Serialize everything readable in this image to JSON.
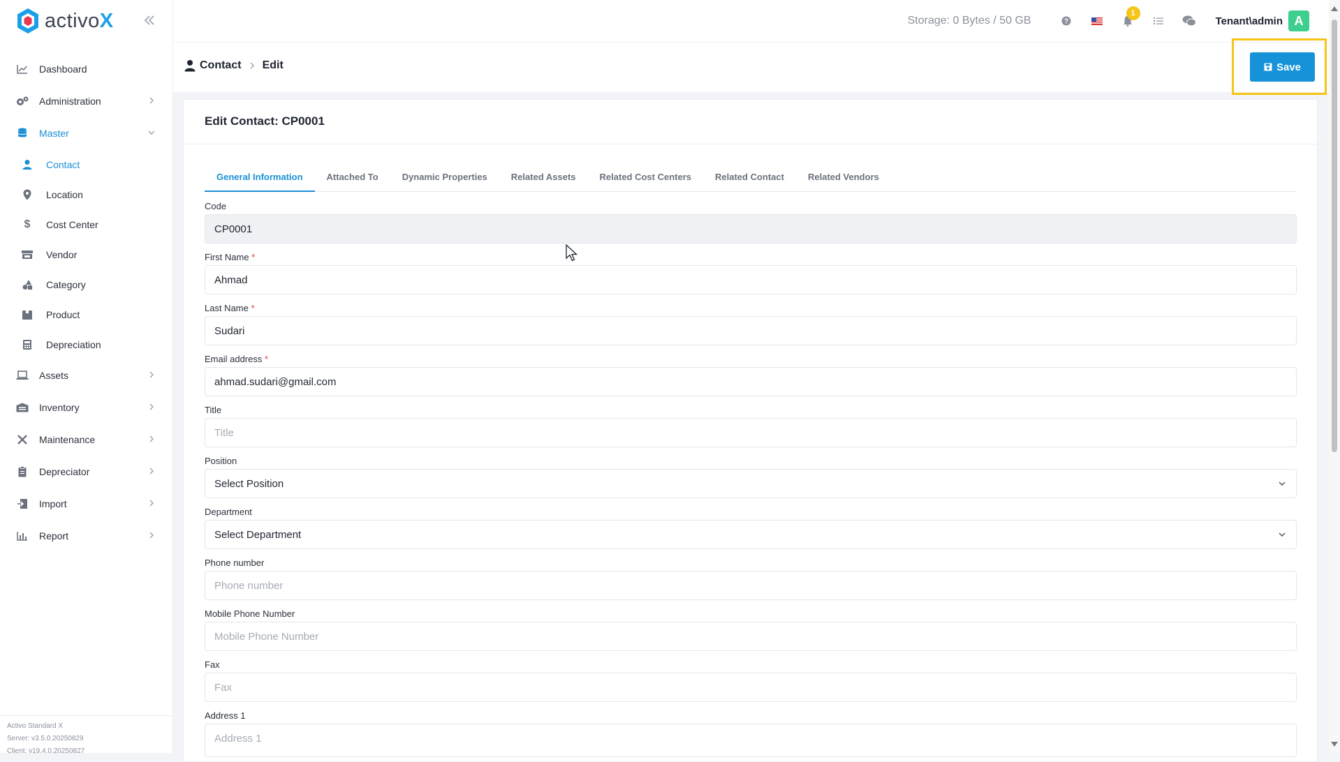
{
  "brand": {
    "name": "activo",
    "x": "X"
  },
  "sidebar": {
    "items": [
      {
        "label": "Dashboard",
        "icon": "chart-line-icon"
      },
      {
        "label": "Administration",
        "icon": "gears-icon"
      },
      {
        "label": "Master",
        "icon": "database-icon"
      },
      {
        "label": "Assets",
        "icon": "laptop-icon"
      },
      {
        "label": "Inventory",
        "icon": "warehouse-icon"
      },
      {
        "label": "Maintenance",
        "icon": "tools-icon"
      },
      {
        "label": "Depreciator",
        "icon": "clipboard-icon"
      },
      {
        "label": "Import",
        "icon": "import-icon"
      },
      {
        "label": "Report",
        "icon": "bar-chart-icon"
      }
    ],
    "master_sub": [
      {
        "label": "Contact",
        "icon": "user-icon"
      },
      {
        "label": "Location",
        "icon": "map-pin-icon"
      },
      {
        "label": "Cost Center",
        "icon": "dollar-icon"
      },
      {
        "label": "Vendor",
        "icon": "store-icon"
      },
      {
        "label": "Category",
        "icon": "shapes-icon"
      },
      {
        "label": "Product",
        "icon": "box-icon"
      },
      {
        "label": "Depreciation",
        "icon": "calculator-icon"
      }
    ],
    "footer": {
      "product": "Activo Standard X",
      "server": "Server: v3.5.0.20250829",
      "client": "Client: v19.4.0.20250827"
    }
  },
  "topbar": {
    "storage": "Storage: 0 Bytes / 50 GB",
    "notification_count": "1",
    "user": "Tenant\\admin",
    "avatar_letter": "A"
  },
  "breadcrumb": {
    "root": "Contact",
    "current": "Edit"
  },
  "toolbar": {
    "save_label": "Save"
  },
  "card": {
    "title": "Edit Contact: CP0001"
  },
  "tabs": [
    "General Information",
    "Attached To",
    "Dynamic Properties",
    "Related Assets",
    "Related Cost Centers",
    "Related Contact",
    "Related Vendors"
  ],
  "form": {
    "code": {
      "label": "Code",
      "value": "CP0001"
    },
    "first_name": {
      "label": "First Name",
      "value": "Ahmad"
    },
    "last_name": {
      "label": "Last Name",
      "value": "Sudari"
    },
    "email": {
      "label": "Email address",
      "value": "ahmad.sudari@gmail.com"
    },
    "title": {
      "label": "Title",
      "placeholder": "Title"
    },
    "position": {
      "label": "Position",
      "value": "Select Position"
    },
    "department": {
      "label": "Department",
      "value": "Select Department"
    },
    "phone": {
      "label": "Phone number",
      "placeholder": "Phone number"
    },
    "mobile": {
      "label": "Mobile Phone Number",
      "placeholder": "Mobile Phone Number"
    },
    "fax": {
      "label": "Fax",
      "placeholder": "Fax"
    },
    "address1": {
      "label": "Address 1",
      "placeholder": "Address 1"
    }
  },
  "colors": {
    "accent": "#1a8fd6",
    "save": "#1592d8",
    "highlight": "#f5c518",
    "avatar": "#3ecf8e"
  }
}
